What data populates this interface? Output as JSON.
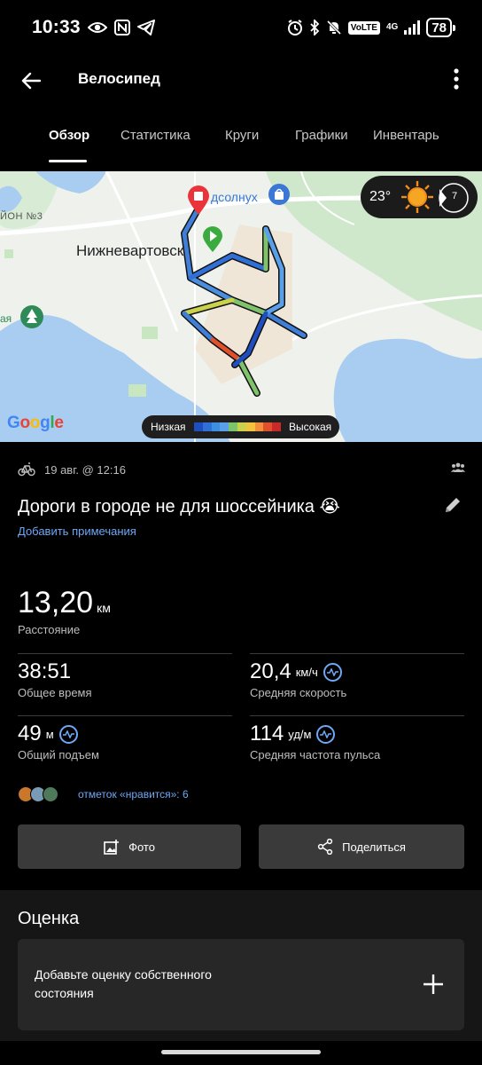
{
  "status_bar": {
    "time": "10:33",
    "volte": "VoLTE",
    "network": "4G",
    "battery": "78"
  },
  "app_bar": {
    "title": "Велосипед"
  },
  "tabs": [
    {
      "label": "Обзор",
      "active": true
    },
    {
      "label": "Статистика",
      "active": false
    },
    {
      "label": "Круги",
      "active": false
    },
    {
      "label": "Графики",
      "active": false
    },
    {
      "label": "Инвентарь",
      "active": false
    }
  ],
  "map": {
    "city": "Нижневартовск",
    "poi": "дсолнух",
    "district": "ЙОН №3",
    "park": "ая",
    "google": "Google",
    "weather": {
      "temp": "23°",
      "wind": "7"
    },
    "legend": {
      "low": "Низкая",
      "high": "Высокая",
      "colors": [
        "#1f4fbf",
        "#2f6fd6",
        "#3f8fe0",
        "#5aa0e8",
        "#7ec36b",
        "#c9d24a",
        "#f2c33c",
        "#f0903a",
        "#e0502d",
        "#c82a2a"
      ]
    }
  },
  "activity": {
    "date": "19 авг. @ 12:16",
    "title": "Дороги в городе не для шоссейника 😭",
    "add_notes": "Добавить примечания"
  },
  "stats": {
    "distance": {
      "value": "13,20",
      "unit": "км",
      "label": "Расстояние"
    },
    "total_time": {
      "value": "38:51",
      "label": "Общее время"
    },
    "avg_speed": {
      "value": "20,4",
      "unit": "км/ч",
      "label": "Средняя скорость"
    },
    "elevation": {
      "value": "49",
      "unit": "м",
      "label": "Общий подъем"
    },
    "avg_hr": {
      "value": "114",
      "unit": "уд/м",
      "label": "Средняя частота пульса"
    }
  },
  "likes": {
    "text": "отметок «нравится»: 6"
  },
  "buttons": {
    "photo": "Фото",
    "share": "Поделиться"
  },
  "rating": {
    "title": "Оценка",
    "card_text": "Добавьте оценку собственного состояния"
  }
}
